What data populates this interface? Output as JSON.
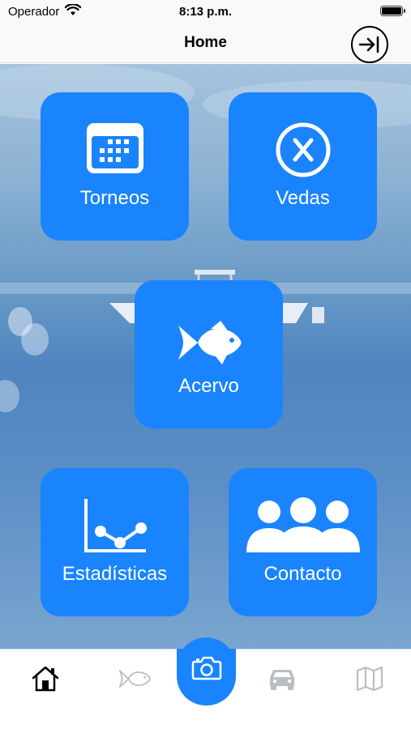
{
  "status_bar": {
    "carrier": "Operador",
    "time": "8:13 p.m."
  },
  "navbar": {
    "title": "Home",
    "logout_icon": "logout-arrow-icon"
  },
  "tiles": {
    "torneos": {
      "label": "Torneos",
      "icon": "calendar-icon"
    },
    "vedas": {
      "label": "Vedas",
      "icon": "close-circle-icon"
    },
    "acervo": {
      "label": "Acervo",
      "icon": "fish-icon"
    },
    "estadisticas": {
      "label": "Estadísticas",
      "icon": "line-chart-icon"
    },
    "contacto": {
      "label": "Contacto",
      "icon": "group-icon"
    }
  },
  "tabbar": {
    "items": [
      {
        "icon": "home-icon",
        "active": true
      },
      {
        "icon": "fish-outline-icon",
        "active": false
      },
      {
        "icon": "camera-icon",
        "active": false,
        "highlighted": true
      },
      {
        "icon": "car-icon",
        "active": false
      },
      {
        "icon": "map-icon",
        "active": false
      }
    ]
  },
  "colors": {
    "accent": "#1a84ff",
    "tile_text": "#ffffff",
    "inactive_tab": "#b9bec4"
  }
}
